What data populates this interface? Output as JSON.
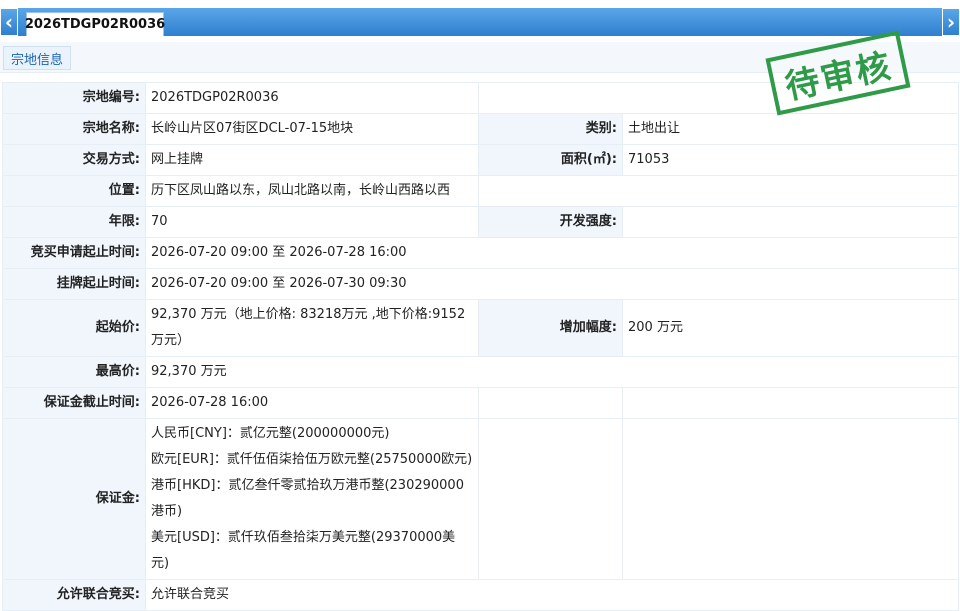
{
  "tab": {
    "title": "2026TDGP02R0036"
  },
  "section": {
    "title": "宗地信息"
  },
  "stamp": {
    "text": "待审核"
  },
  "rows": {
    "parcel_no": {
      "label": "宗地编号:",
      "value": "2026TDGP02R0036"
    },
    "parcel_name": {
      "label": "宗地名称:",
      "value": "长岭山片区07街区DCL-07-15地块"
    },
    "category": {
      "label": "类别:",
      "value": "土地出让"
    },
    "trade_method": {
      "label": "交易方式:",
      "value": "网上挂牌"
    },
    "area": {
      "label": "面积(㎡):",
      "value": "71053"
    },
    "location": {
      "label": "位置:",
      "value": "历下区凤山路以东，凤山北路以南，长岭山西路以西"
    },
    "term": {
      "label": "年限:",
      "value": "70"
    },
    "density": {
      "label": "开发强度:",
      "value": ""
    },
    "apply_time": {
      "label": "竞买申请起止时间:",
      "value": "2026-07-20 09:00 至 2026-07-28 16:00"
    },
    "listing_time": {
      "label": "挂牌起止时间:",
      "value": "2026-07-20 09:00 至 2026-07-30 09:30"
    },
    "start_price": {
      "label": "起始价:",
      "value": "92,370 万元（地上价格: 83218万元 ,地下价格:9152万元）"
    },
    "increment": {
      "label": "增加幅度:",
      "value": "200 万元"
    },
    "max_price": {
      "label": "最高价:",
      "value": "92,370 万元"
    },
    "deposit_deadline": {
      "label": "保证金截止时间:",
      "value": "2026-07-28 16:00"
    },
    "deposit": {
      "label": "保证金:",
      "cny": "人民币[CNY]：贰亿元整(200000000元)",
      "eur": "欧元[EUR]：贰仟伍佰柒拾伍万欧元整(25750000欧元)",
      "hkd": "港币[HKD]：贰亿叁仟零贰拾玖万港币整(230290000港币)",
      "usd": "美元[USD]：贰仟玖佰叁拾柒万美元整(29370000美元)"
    },
    "joint_bid": {
      "label": "允许联合竞买:",
      "value": "允许联合竞买"
    }
  }
}
